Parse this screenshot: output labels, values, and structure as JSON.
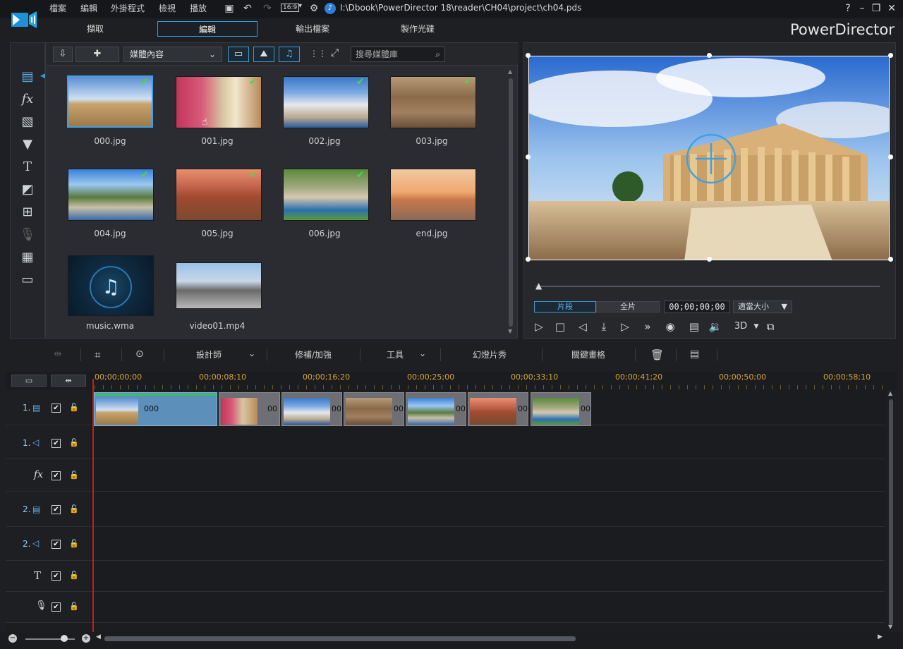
{
  "app": {
    "menu": [
      "檔案",
      "編輯",
      "外掛程式",
      "檢視",
      "播放"
    ],
    "aspect": "16:9",
    "project_path": "I:\\Dbook\\PowerDirector 18\\reader\\CH04\\project\\ch04.pds",
    "help": "?",
    "brand": "PowerDirector"
  },
  "modes": [
    "擷取",
    "編輯",
    "輸出檔案",
    "製作光碟"
  ],
  "library": {
    "dropdown": "媒體內容",
    "search_placeholder": "搜尋媒體庫",
    "items": [
      {
        "label": "000.jpg",
        "checked": true,
        "selected": true
      },
      {
        "label": "001.jpg",
        "checked": true
      },
      {
        "label": "002.jpg",
        "checked": true
      },
      {
        "label": "003.jpg",
        "checked": true
      },
      {
        "label": "004.jpg",
        "checked": true
      },
      {
        "label": "005.jpg",
        "checked": true
      },
      {
        "label": "006.jpg",
        "checked": true
      },
      {
        "label": "end.jpg",
        "checked": false
      },
      {
        "label": "music.wma",
        "checked": false
      },
      {
        "label": "video01.mp4",
        "checked": false
      }
    ]
  },
  "preview": {
    "clip_mode": "片段",
    "full_mode": "全片",
    "timecode": "00;00;00;00",
    "fit": "適當大小",
    "threed": "3D"
  },
  "edit_toolbar": {
    "designer": "設計師",
    "fix": "修補/加強",
    "tools": "工具",
    "slideshow": "幻燈片秀",
    "keyframe": "關鍵畫格"
  },
  "timeline": {
    "ruler": [
      "00;00;00;00",
      "00;00;08;10",
      "00;00;16;20",
      "00;00;25;00",
      "00;00;33;10",
      "00;00;41;20",
      "00;00;50;00",
      "00;00;58;10"
    ],
    "tracks": [
      {
        "num": "1.",
        "icon": "video-track-icon"
      },
      {
        "num": "1.",
        "icon": "audio-track-icon"
      },
      {
        "num": "",
        "icon": "fx-track-icon"
      },
      {
        "num": "2.",
        "icon": "video-track-icon"
      },
      {
        "num": "2.",
        "icon": "audio-track-icon"
      },
      {
        "num": "",
        "icon": "title-track-icon"
      },
      {
        "num": "",
        "icon": "voice-track-icon"
      }
    ],
    "clips": [
      {
        "label": "000"
      },
      {
        "label": "00"
      },
      {
        "label": "00"
      },
      {
        "label": "00"
      },
      {
        "label": "00"
      },
      {
        "label": "00"
      },
      {
        "label": "00"
      }
    ]
  }
}
